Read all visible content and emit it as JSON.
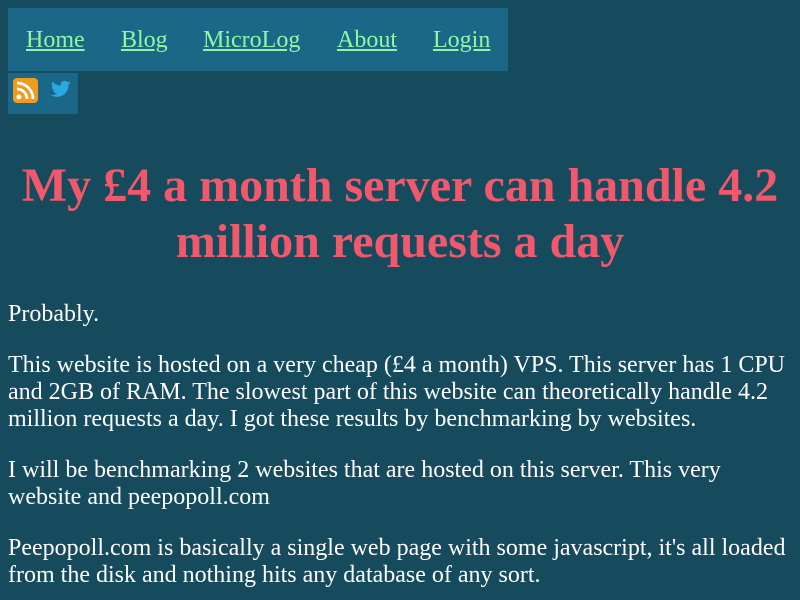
{
  "nav": {
    "items": [
      {
        "label": "Home"
      },
      {
        "label": "Blog"
      },
      {
        "label": "MicroLog"
      },
      {
        "label": "About"
      },
      {
        "label": "Login"
      }
    ]
  },
  "social": {
    "icons": [
      "rss-icon",
      "twitter-icon"
    ],
    "rss_color": "#f29a1e",
    "twitter_color": "#2aa9e0"
  },
  "colors": {
    "background": "#164a5d",
    "bar": "#1b6787",
    "link": "#8df7a5",
    "title": "#f0586c",
    "text": "#ffffff"
  },
  "article": {
    "title": "My £4 a month server can handle 4.2 million requests a day",
    "paragraphs": [
      "Probably.",
      "This website is hosted on a very cheap (£4 a month) VPS. This server has 1 CPU and 2GB of RAM. The slowest part of this website can theoretically handle 4.2 million requests a day. I got these results by benchmarking by websites.",
      "I will be benchmarking 2 websites that are hosted on this server. This very website and peepopoll.com",
      "Peepopoll.com is basically a single web page with some javascript, it's all loaded from the disk and nothing hits any database of any sort."
    ]
  }
}
